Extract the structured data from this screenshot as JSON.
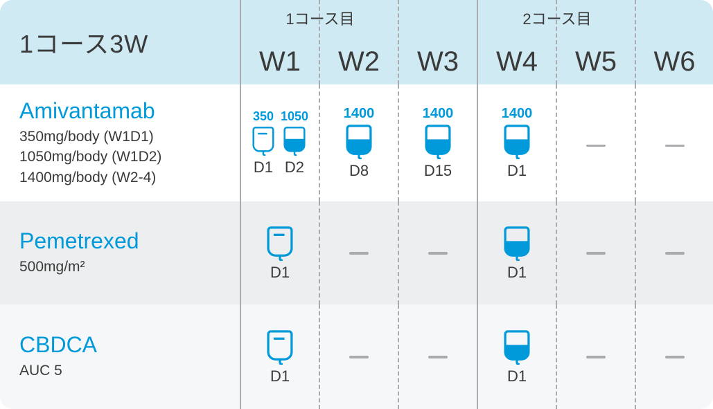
{
  "header": {
    "title": "1コース3W",
    "course1": "1コース目",
    "course2": "2コース目",
    "weeks": [
      "W1",
      "W2",
      "W3",
      "W4",
      "W5",
      "W6"
    ]
  },
  "drugs": [
    {
      "name": "Amivantamab",
      "doses": [
        "350mg/body   (W1D1)",
        "1050mg/body (W1D2)",
        "1400mg/body (W2-4)"
      ],
      "cells": [
        {
          "type": "twin",
          "a_dose": "350",
          "a_day": "D1",
          "b_dose": "1050",
          "b_day": "D2"
        },
        {
          "type": "bag",
          "dose": "1400",
          "day": "D8"
        },
        {
          "type": "bag",
          "dose": "1400",
          "day": "D15"
        },
        {
          "type": "bag",
          "dose": "1400",
          "day": "D1"
        },
        {
          "type": "dash"
        },
        {
          "type": "dash"
        }
      ]
    },
    {
      "name": "Pemetrexed",
      "doses": [
        "500mg/m²"
      ],
      "cells": [
        {
          "type": "bag",
          "day": "D1"
        },
        {
          "type": "dash"
        },
        {
          "type": "dash"
        },
        {
          "type": "bag",
          "day": "D1"
        },
        {
          "type": "dash"
        },
        {
          "type": "dash"
        }
      ]
    },
    {
      "name": "CBDCA",
      "doses": [
        "AUC 5"
      ],
      "cells": [
        {
          "type": "bag",
          "day": "D1"
        },
        {
          "type": "dash"
        },
        {
          "type": "dash"
        },
        {
          "type": "bag",
          "day": "D1"
        },
        {
          "type": "dash"
        },
        {
          "type": "dash"
        }
      ]
    }
  ]
}
